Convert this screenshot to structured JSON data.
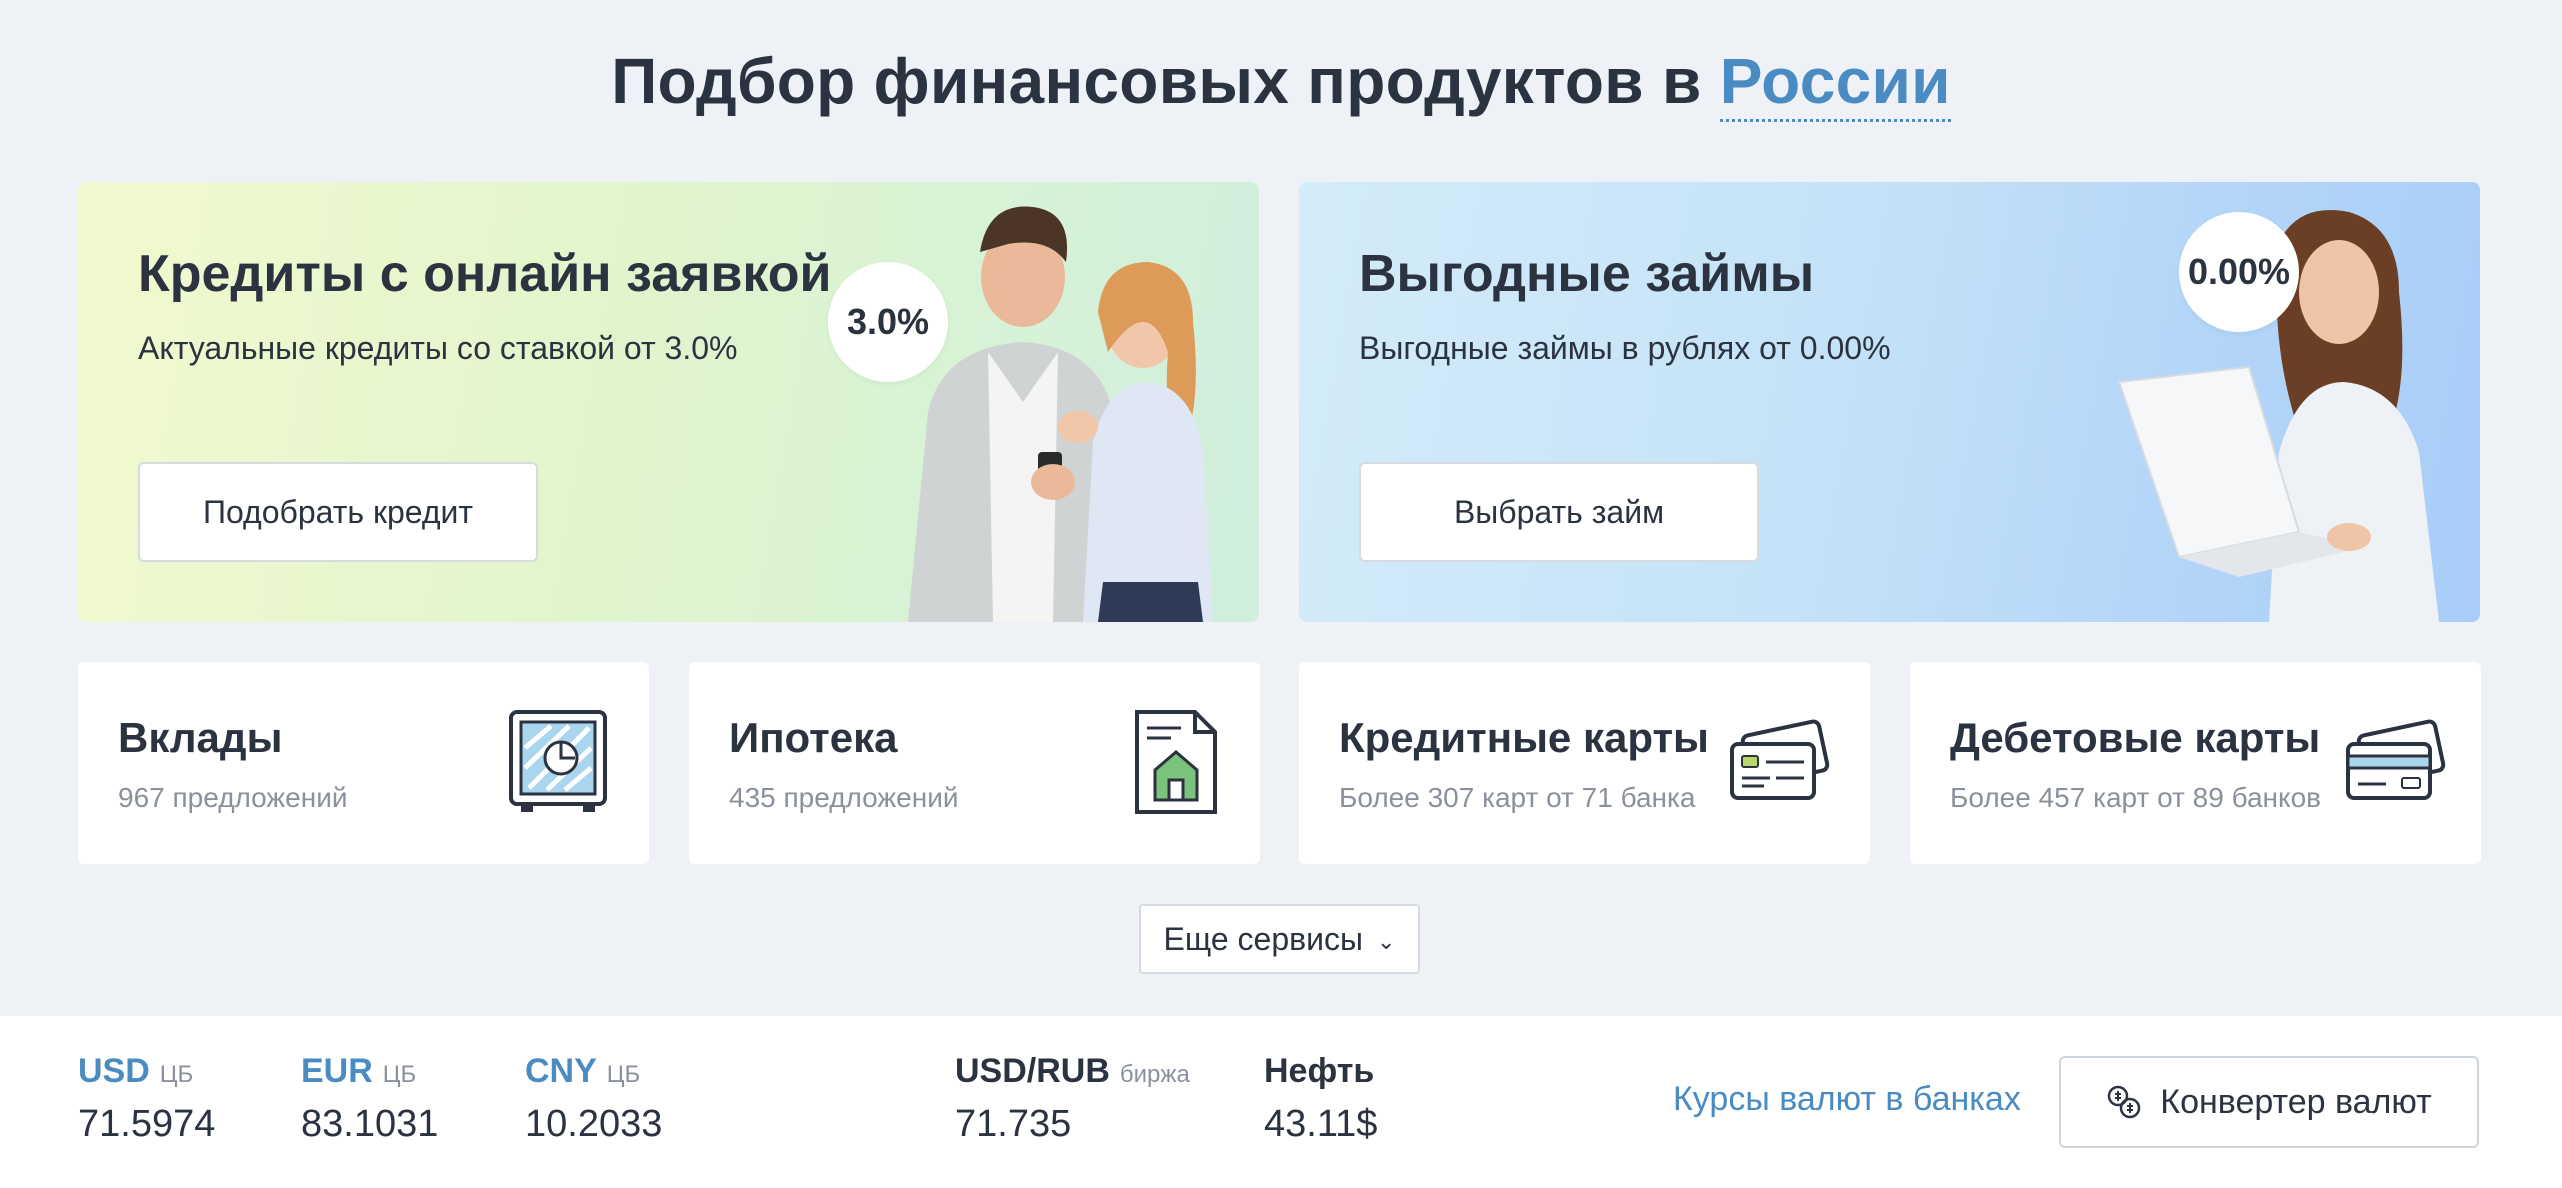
{
  "header": {
    "title_prefix": "Подбор финансовых продуктов в",
    "region": "России"
  },
  "banners": {
    "credit": {
      "title": "Кредиты с онлайн заявкой",
      "subtitle": "Актуальные кредиты со ставкой от 3.0%",
      "button": "Подобрать кредит",
      "badge": "3.0%"
    },
    "loan": {
      "title": "Выгодные займы",
      "subtitle": "Выгодные займы в рублях от 0.00%",
      "button": "Выбрать займ",
      "badge": "0.00%"
    }
  },
  "cards": [
    {
      "title": "Вклады",
      "subtitle": "967 предложений",
      "icon": "safe-icon"
    },
    {
      "title": "Ипотека",
      "subtitle": "435 предложений",
      "icon": "mortgage-house-document-icon"
    },
    {
      "title": "Кредитные карты",
      "subtitle": "Более 307 карт от 71 банка",
      "icon": "credit-cards-icon"
    },
    {
      "title": "Дебетовые карты",
      "subtitle": "Более 457 карт от 89 банков",
      "icon": "debit-cards-icon"
    }
  ],
  "more_services": {
    "label": "Еще сервисы",
    "icon": "chevron-down-icon"
  },
  "rates": {
    "usd": {
      "code": "USD",
      "source": "ЦБ",
      "value": "71.5974"
    },
    "eur": {
      "code": "EUR",
      "source": "ЦБ",
      "value": "83.1031"
    },
    "cny": {
      "code": "CNY",
      "source": "ЦБ",
      "value": "10.2033"
    },
    "usdrub": {
      "code": "USD/RUB",
      "source": "биржа",
      "value": "71.735"
    },
    "oil": {
      "code": "Нефть",
      "value": "43.11$"
    }
  },
  "links": {
    "banks_rates": "Курсы валют в банках",
    "converter": "Конвертер валют"
  },
  "colors": {
    "accent": "#4a8bc2",
    "text": "#2b3240",
    "muted": "#8a919c",
    "background": "#eef2f7"
  }
}
